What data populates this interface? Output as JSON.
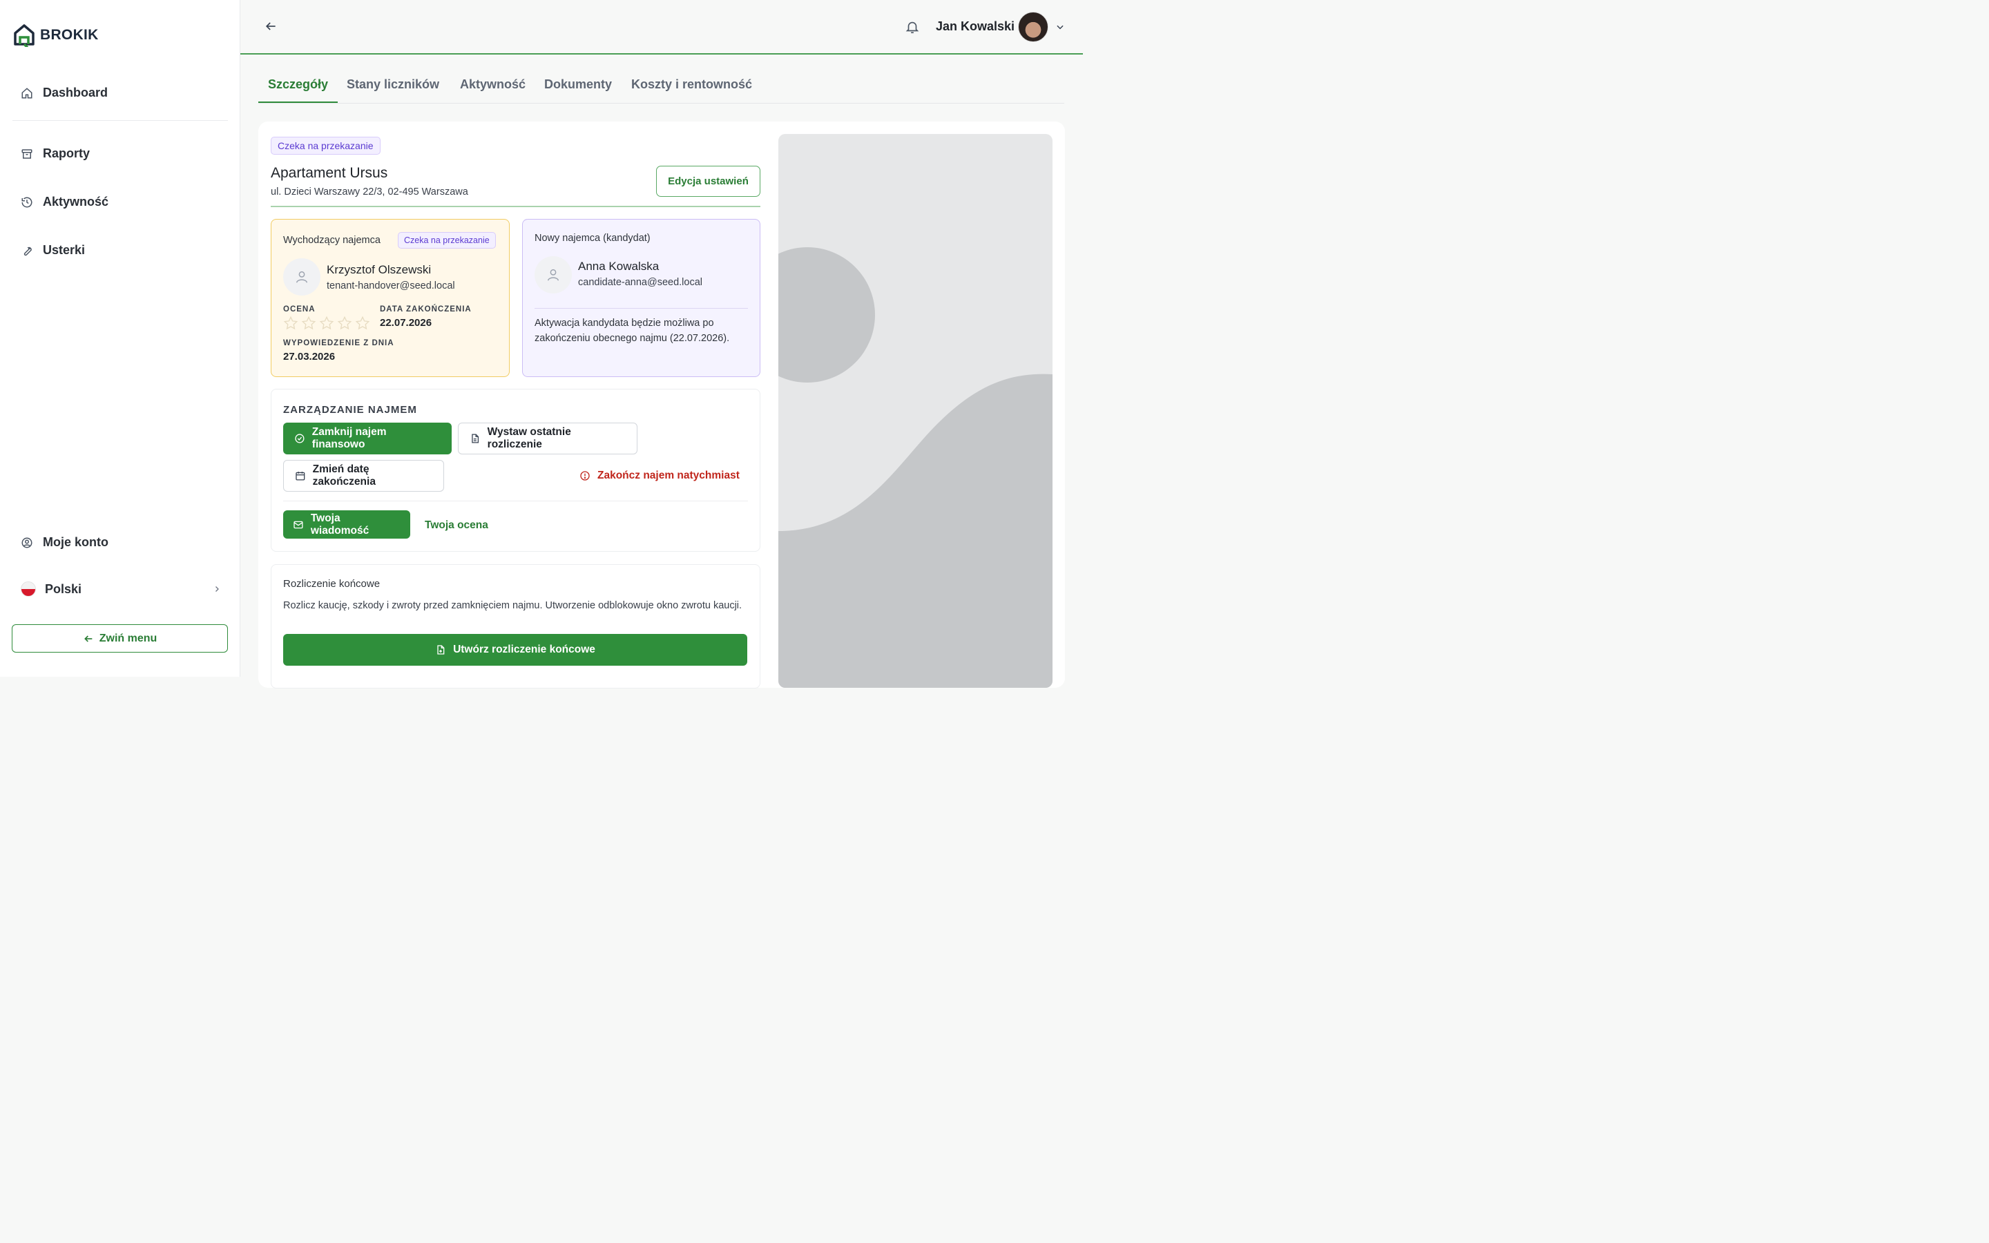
{
  "brand": {
    "name": "BROKIK"
  },
  "sidebar": {
    "items": [
      {
        "label": "Dashboard",
        "icon": "home-icon"
      },
      {
        "label": "Raporty",
        "icon": "archive-icon"
      },
      {
        "label": "Aktywność",
        "icon": "history-icon"
      },
      {
        "label": "Usterki",
        "icon": "wrench-icon"
      }
    ],
    "account": {
      "label": "Moje konto",
      "icon": "user-circle-icon"
    },
    "language": {
      "label": "Polski",
      "icon": "flag-poland-icon"
    },
    "collapse_label": "Zwiń menu"
  },
  "header": {
    "user_name": "Jan Kowalski"
  },
  "tabs": [
    {
      "label": "Szczegóły",
      "active": true
    },
    {
      "label": "Stany liczników",
      "active": false
    },
    {
      "label": "Aktywność",
      "active": false
    },
    {
      "label": "Dokumenty",
      "active": false
    },
    {
      "label": "Koszty i rentowność",
      "active": false
    }
  ],
  "property": {
    "status_badge": "Czeka na przekazanie",
    "title": "Apartament Ursus",
    "address": "ul. Dzieci Warszawy 22/3, 02-495 Warszawa",
    "edit_button": "Edycja ustawień"
  },
  "outgoing_tenant": {
    "label": "Wychodzący najemca",
    "badge": "Czeka na przekazanie",
    "name": "Krzysztof Olszewski",
    "email": "tenant-handover@seed.local",
    "rating_label": "OCENA",
    "rating": 0,
    "rating_max": 5,
    "end_date_label": "DATA ZAKOŃCZENIA",
    "end_date": "22.07.2026",
    "notice_label": "WYPOWIEDZENIE Z DNIA",
    "notice_date": "27.03.2026"
  },
  "new_tenant": {
    "label": "Nowy najemca (kandydat)",
    "name": "Anna Kowalska",
    "email": "candidate-anna@seed.local",
    "note": "Aktywacja kandydata będzie możliwa po zakończeniu obecnego najmu (22.07.2026)."
  },
  "management": {
    "title": "ZARZĄDZANIE NAJMEM",
    "close_financially": "Zamknij najem finansowo",
    "issue_last_settlement": "Wystaw ostatnie rozliczenie",
    "change_end_date": "Zmień datę zakończenia",
    "terminate_now": "Zakończ najem natychmiast",
    "your_message": "Twoja wiadomość",
    "your_rating": "Twoja ocena"
  },
  "settlement": {
    "title": "Rozliczenie końcowe",
    "description": "Rozlicz kaucję, szkody i zwroty przed zamknięciem najmu. Utworzenie odblokowuje okno zwrotu kaucji.",
    "button": "Utwórz rozliczenie końcowe"
  },
  "colors": {
    "primary_green": "#2f8f3b",
    "danger_red": "#c0261c",
    "badge_purple": "#5b3bd1",
    "warning_border": "#f1cc63"
  }
}
